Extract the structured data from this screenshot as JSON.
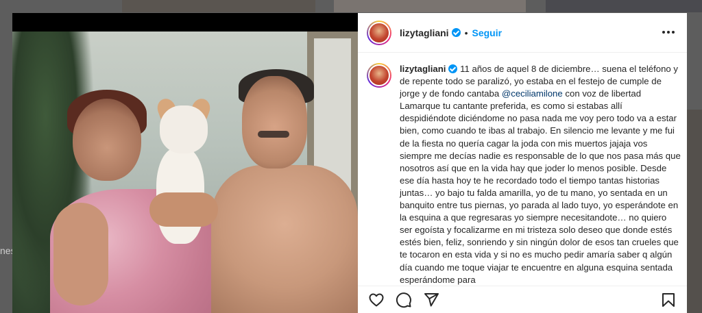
{
  "background": {
    "side_text_1": "nes"
  },
  "post": {
    "username": "lizytagliani",
    "follow_label": "Seguir",
    "separator": "•",
    "caption_user": "lizytagliani",
    "caption_part1": " 11 años de aquel 8 de diciembre… suena el teléfono y de repente todo se paralizó, yo estaba en el festejo de cumple de jorge y de fondo cantaba ",
    "caption_mention": "@ceciliamilone",
    "caption_part2": " con voz de libertad Lamarque tu cantante preferida, es como si estabas allí despidiéndote diciéndome no pasa nada me voy pero todo va a estar bien, como cuando te ibas al trabajo. En silencio me levante y me fui de la fiesta no quería cagar la joda con mis muertos jajaja vos siempre me decías nadie es responsable de lo que nos pasa más que nosotros así que en la vida hay que joder lo menos posible. Desde ese día hasta hoy te he recordado todo el tiempo tantas historias juntas… yo bajo tu falda amarilla, yo de tu mano, yo sentada en un banquito entre tus piernas, yo parada al lado tuyo, yo esperándote en la esquina a que regresaras yo siempre necesitandote… no quiero ser egoísta y focalizarme en mi tristeza solo deseo que donde estés estés bien, feliz, sonriendo y sin ningún dolor de esos tan crueles que te tocaron en esta vida y si no es mucho pedir amaría saber q algún día cuando me toque viajar te encuentre en alguna esquina sentada esperándome para"
  },
  "actions": {
    "like": "heart-icon",
    "comment": "comment-icon",
    "share": "share-icon",
    "save": "bookmark-icon"
  },
  "colors": {
    "accent": "#0095f6",
    "mention": "#00376b",
    "text": "#262626"
  }
}
